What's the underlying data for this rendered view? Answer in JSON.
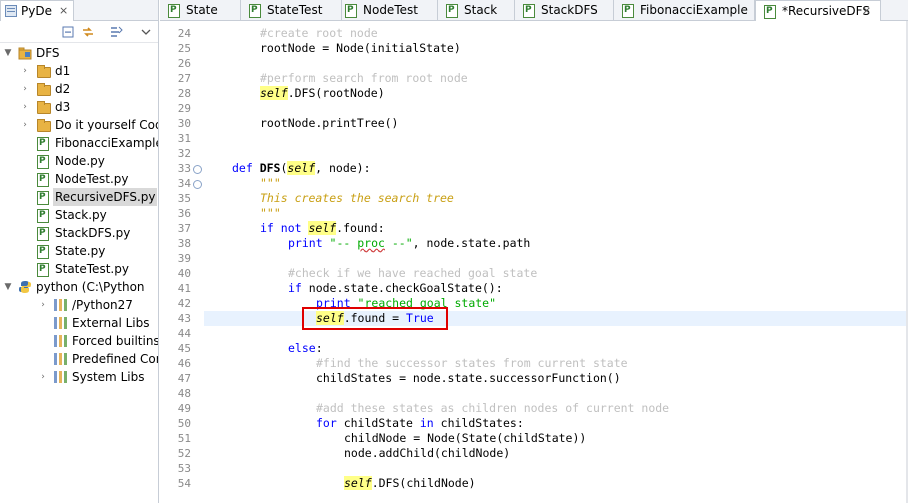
{
  "left_panel": {
    "tab_label": "PyDe",
    "tab_close": "⨯",
    "tree": [
      {
        "label": "DFS",
        "kind": "project",
        "arrow": "▼",
        "indent": 0
      },
      {
        "label": "d1",
        "kind": "folder",
        "arrow": "›",
        "indent": 1
      },
      {
        "label": "d2",
        "kind": "folder",
        "arrow": "›",
        "indent": 1
      },
      {
        "label": "d3",
        "kind": "folder",
        "arrow": "›",
        "indent": 1
      },
      {
        "label": "Do it yourself Code",
        "kind": "folder",
        "arrow": "›",
        "indent": 1
      },
      {
        "label": "FibonacciExample.",
        "kind": "pyfile",
        "arrow": "",
        "indent": 1
      },
      {
        "label": "Node.py",
        "kind": "pyfile",
        "arrow": "",
        "indent": 1
      },
      {
        "label": "NodeTest.py",
        "kind": "pyfile",
        "arrow": "",
        "indent": 1
      },
      {
        "label": "RecursiveDFS.py",
        "kind": "pyfile",
        "arrow": "",
        "indent": 1,
        "selected": true
      },
      {
        "label": "Stack.py",
        "kind": "pyfile",
        "arrow": "",
        "indent": 1
      },
      {
        "label": "StackDFS.py",
        "kind": "pyfile",
        "arrow": "",
        "indent": 1
      },
      {
        "label": "State.py",
        "kind": "pyfile",
        "arrow": "",
        "indent": 1
      },
      {
        "label": "StateTest.py",
        "kind": "pyfile",
        "arrow": "",
        "indent": 1
      },
      {
        "label": "python  (C:\\Python",
        "kind": "interpreter",
        "arrow": "▼",
        "indent": 0
      },
      {
        "label": "/Python27",
        "kind": "lib",
        "arrow": "›",
        "indent": 2
      },
      {
        "label": "External Libs",
        "kind": "lib",
        "arrow": "",
        "indent": 2
      },
      {
        "label": "Forced builtins",
        "kind": "lib",
        "arrow": "",
        "indent": 2
      },
      {
        "label": "Predefined Com",
        "kind": "lib",
        "arrow": "",
        "indent": 2
      },
      {
        "label": "System Libs",
        "kind": "lib",
        "arrow": "›",
        "indent": 2
      }
    ]
  },
  "editor": {
    "tabs": [
      {
        "label": "State",
        "active": false
      },
      {
        "label": "StateTest",
        "active": false
      },
      {
        "label": "NodeTest",
        "active": false
      },
      {
        "label": "Stack",
        "active": false
      },
      {
        "label": "StackDFS",
        "active": false
      },
      {
        "label": "FibonacciExample",
        "active": false
      },
      {
        "label": "*RecursiveDFS",
        "active": true
      }
    ],
    "active_tab_close": "⨯",
    "current_line": 43,
    "highlighted_line": 43,
    "lines": [
      {
        "n": 24,
        "fold": "",
        "indent": 2,
        "tokens": [
          [
            "cm",
            "#create root node"
          ]
        ]
      },
      {
        "n": 25,
        "fold": "",
        "indent": 2,
        "tokens": [
          [
            "",
            "rootNode = Node(initialState)"
          ]
        ]
      },
      {
        "n": 26,
        "fold": "",
        "indent": 0,
        "tokens": []
      },
      {
        "n": 27,
        "fold": "",
        "indent": 2,
        "tokens": [
          [
            "cm",
            "#perform search from root node"
          ]
        ]
      },
      {
        "n": 28,
        "fold": "",
        "indent": 2,
        "tokens": [
          [
            "slf",
            "self"
          ],
          [
            "",
            ".DFS(rootNode)"
          ]
        ]
      },
      {
        "n": 29,
        "fold": "",
        "indent": 0,
        "tokens": []
      },
      {
        "n": 30,
        "fold": "",
        "indent": 2,
        "tokens": [
          [
            "",
            "rootNode.printTree()"
          ]
        ]
      },
      {
        "n": 31,
        "fold": "",
        "indent": 0,
        "tokens": []
      },
      {
        "n": 32,
        "fold": "",
        "indent": 0,
        "tokens": []
      },
      {
        "n": 33,
        "fold": "⊖",
        "indent": 1,
        "tokens": [
          [
            "kw",
            "def "
          ],
          [
            "fn",
            "DFS"
          ],
          [
            "",
            "("
          ],
          [
            "slf",
            "self"
          ],
          [
            "",
            ", node):"
          ]
        ]
      },
      {
        "n": 34,
        "fold": "⊖",
        "indent": 2,
        "tokens": [
          [
            "ds",
            "\"\"\""
          ]
        ]
      },
      {
        "n": 35,
        "fold": "",
        "indent": 2,
        "tokens": [
          [
            "dsi",
            "This creates the search tree"
          ]
        ]
      },
      {
        "n": 36,
        "fold": "",
        "indent": 2,
        "tokens": [
          [
            "ds",
            "\"\"\""
          ]
        ]
      },
      {
        "n": 37,
        "fold": "",
        "indent": 2,
        "tokens": [
          [
            "kw",
            "if not "
          ],
          [
            "slf",
            "self"
          ],
          [
            "",
            ".found:"
          ]
        ]
      },
      {
        "n": 38,
        "fold": "",
        "indent": 3,
        "tokens": [
          [
            "kw",
            "print "
          ],
          [
            "st",
            "\"-- "
          ],
          [
            "sq st",
            "proc"
          ],
          [
            "st",
            " --\""
          ],
          [
            "",
            ", node.state.path"
          ]
        ]
      },
      {
        "n": 39,
        "fold": "",
        "indent": 0,
        "tokens": []
      },
      {
        "n": 40,
        "fold": "",
        "indent": 3,
        "tokens": [
          [
            "cm",
            "#check if we have reached goal state"
          ]
        ]
      },
      {
        "n": 41,
        "fold": "",
        "indent": 3,
        "tokens": [
          [
            "kw",
            "if "
          ],
          [
            "",
            "node.state.checkGoalState():"
          ]
        ]
      },
      {
        "n": 42,
        "fold": "",
        "indent": 4,
        "tokens": [
          [
            "kw",
            "print "
          ],
          [
            "st",
            "\"reached goal state\""
          ]
        ]
      },
      {
        "n": 43,
        "fold": "",
        "indent": 4,
        "tokens": [
          [
            "slf",
            "self"
          ],
          [
            "",
            ".found = "
          ],
          [
            "kw",
            "True"
          ]
        ]
      },
      {
        "n": 44,
        "fold": "",
        "indent": 0,
        "tokens": []
      },
      {
        "n": 45,
        "fold": "",
        "indent": 3,
        "tokens": [
          [
            "kw",
            "else"
          ],
          [
            "",
            ":"
          ]
        ]
      },
      {
        "n": 46,
        "fold": "",
        "indent": 4,
        "tokens": [
          [
            "cm",
            "#find the successor states from current state"
          ]
        ]
      },
      {
        "n": 47,
        "fold": "",
        "indent": 4,
        "tokens": [
          [
            "",
            "childStates = node.state.successorFunction()"
          ]
        ]
      },
      {
        "n": 48,
        "fold": "",
        "indent": 0,
        "tokens": []
      },
      {
        "n": 49,
        "fold": "",
        "indent": 4,
        "tokens": [
          [
            "cm",
            "#add these states as children nodes of current node"
          ]
        ]
      },
      {
        "n": 50,
        "fold": "",
        "indent": 4,
        "tokens": [
          [
            "kw",
            "for "
          ],
          [
            "",
            "childState "
          ],
          [
            "kw",
            "in "
          ],
          [
            "",
            "childStates:"
          ]
        ]
      },
      {
        "n": 51,
        "fold": "",
        "indent": 5,
        "tokens": [
          [
            "",
            "childNode = Node(State(childState))"
          ]
        ]
      },
      {
        "n": 52,
        "fold": "",
        "indent": 5,
        "tokens": [
          [
            "",
            "node.addChild(childNode)"
          ]
        ]
      },
      {
        "n": 53,
        "fold": "",
        "indent": 0,
        "tokens": []
      },
      {
        "n": 54,
        "fold": "",
        "indent": 5,
        "tokens": [
          [
            "slf",
            "self"
          ],
          [
            "",
            ".DFS(childNode)"
          ]
        ]
      }
    ]
  },
  "colors": {
    "keyword": "#0000ff",
    "comment": "#c0c0c0",
    "string": "#00aa00",
    "docstring": "#c9a015",
    "self_bg": "#ffff88",
    "annotation_box": "#e00000",
    "current_line_bg": "#e8f2fe"
  }
}
